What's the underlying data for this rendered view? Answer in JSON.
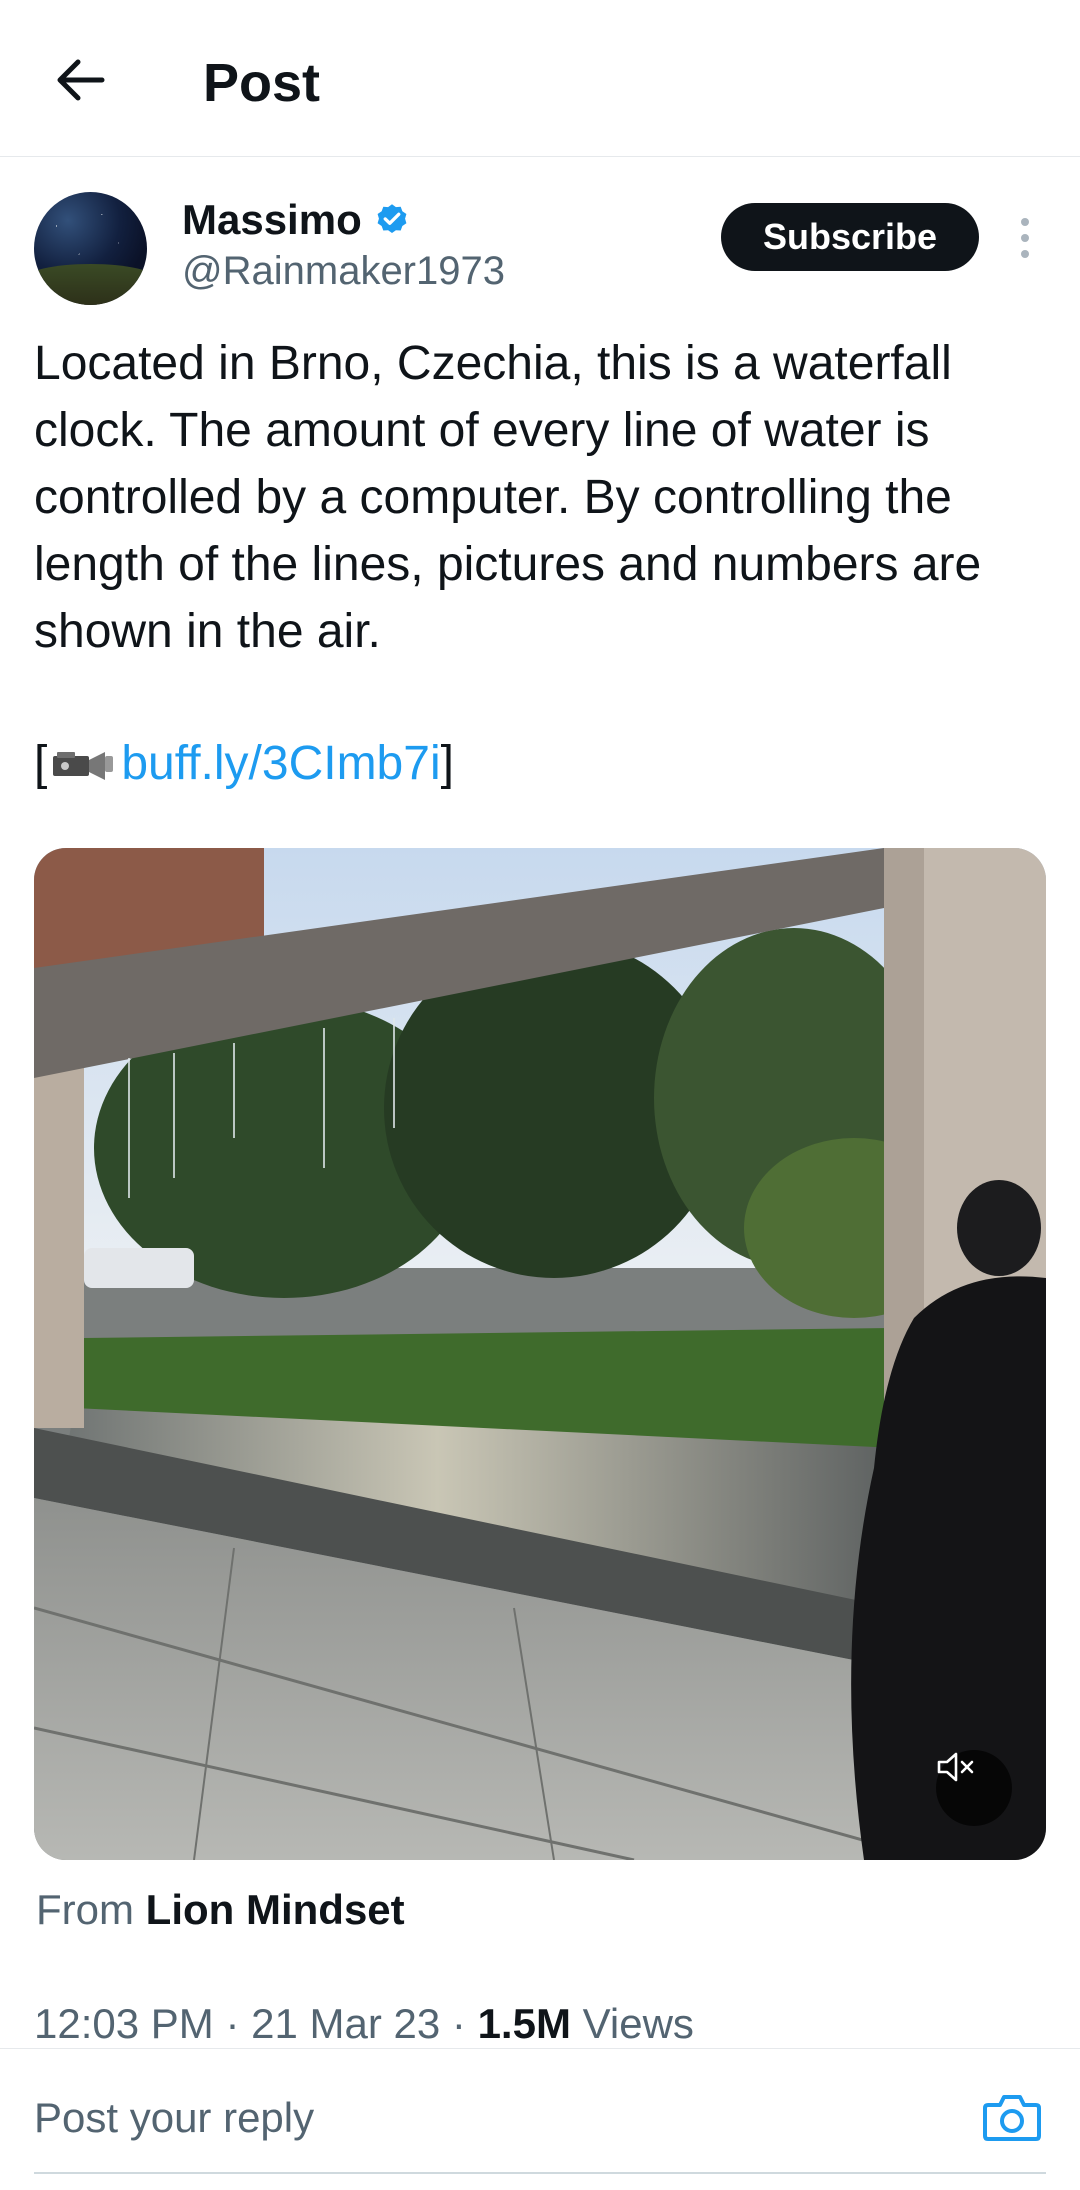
{
  "header": {
    "title": "Post",
    "back_icon": "arrow-left-icon"
  },
  "author": {
    "name": "Massimo",
    "handle": "@Rainmaker1973",
    "verified_icon": "verified-badge-icon",
    "verified_color": "#1d9bf0"
  },
  "actions": {
    "subscribe_label": "Subscribe",
    "more_icon": "more-vertical-icon"
  },
  "post": {
    "text": "Located in Brno, Czechia, this is a waterfall clock. The amount of every line of water is controlled by a computer. By controlling the length of the lines, pictures and numbers are shown in the air.",
    "link_prefix": "[",
    "link_text": "buff.ly/3CImb7i",
    "link_suffix": "]",
    "link_color": "#1d9bf0",
    "video_icon": "video-camera-icon"
  },
  "media": {
    "mute_icon": "speaker-muted-icon"
  },
  "source": {
    "prefix": "From",
    "name": "Lion Mindset"
  },
  "meta": {
    "time": "12:03 PM",
    "separator": "·",
    "date": "21 Mar 23",
    "views_count": "1.5M",
    "views_label": "Views"
  },
  "reply": {
    "placeholder": "Post your reply",
    "camera_icon": "camera-icon",
    "camera_color": "#1d9bf0"
  }
}
